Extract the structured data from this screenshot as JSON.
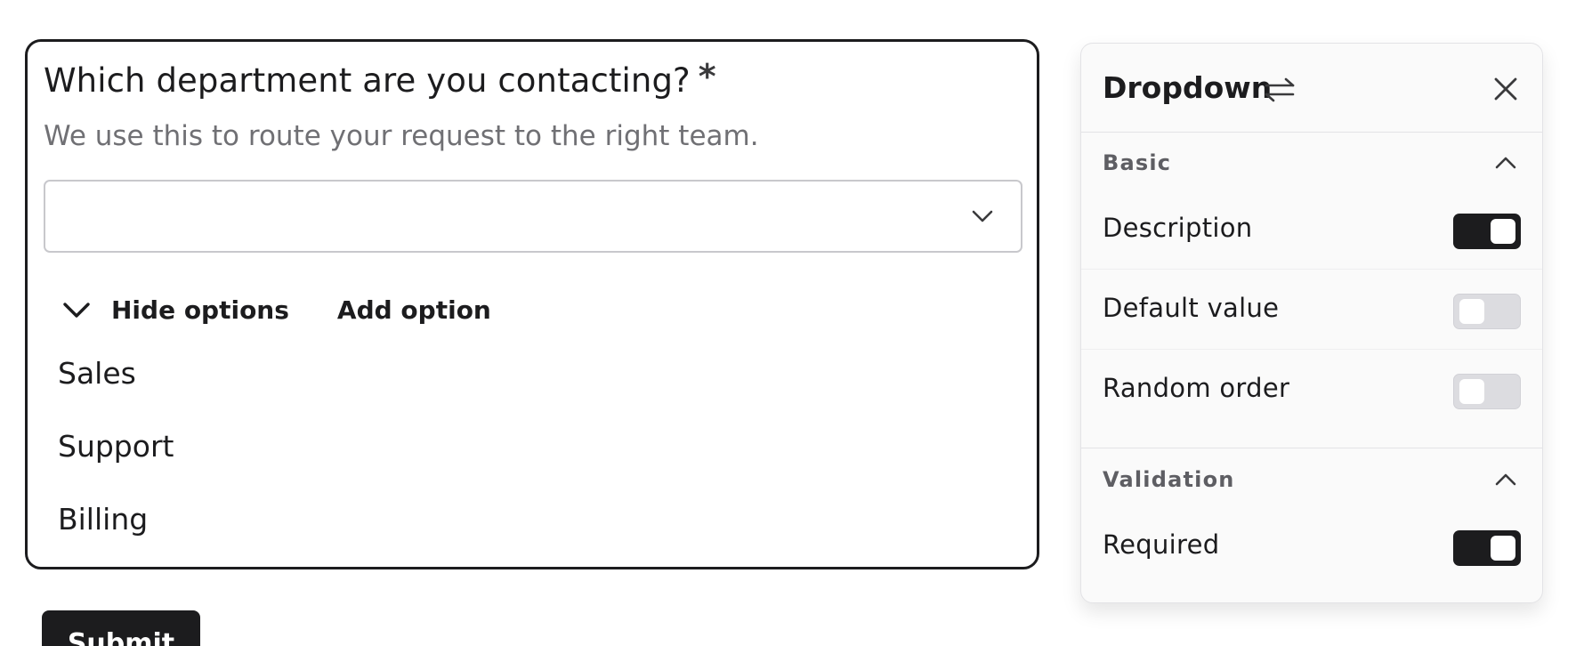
{
  "question": {
    "title": "Which department are you contacting?",
    "required_marker": "*",
    "description": "We use this to route your request to the right team.",
    "select": {
      "value": "",
      "icon": "chevron-down-icon"
    },
    "hide_options_label": "Hide options",
    "add_option_label": "Add option",
    "options": [
      "Sales",
      "Support",
      "Billing"
    ]
  },
  "submit_label": "Submit",
  "settings_panel": {
    "title": "Dropdown",
    "title_icon": "swap-icon",
    "close_icon": "close-icon",
    "sections": [
      {
        "title": "Basic",
        "expanded": true,
        "settings": [
          {
            "label": "Description",
            "enabled": true
          },
          {
            "label": "Default value",
            "enabled": false
          },
          {
            "label": "Random order",
            "enabled": false
          }
        ]
      },
      {
        "title": "Validation",
        "expanded": true,
        "settings": [
          {
            "label": "Required",
            "enabled": true
          }
        ]
      }
    ]
  },
  "colors": {
    "text": "#1c1c1e",
    "muted_text": "#707074",
    "toggle_on": "#1c1c1e",
    "toggle_off": "#dcdce0",
    "panel_bg": "#fafafa",
    "border": "#e3e3e6"
  }
}
